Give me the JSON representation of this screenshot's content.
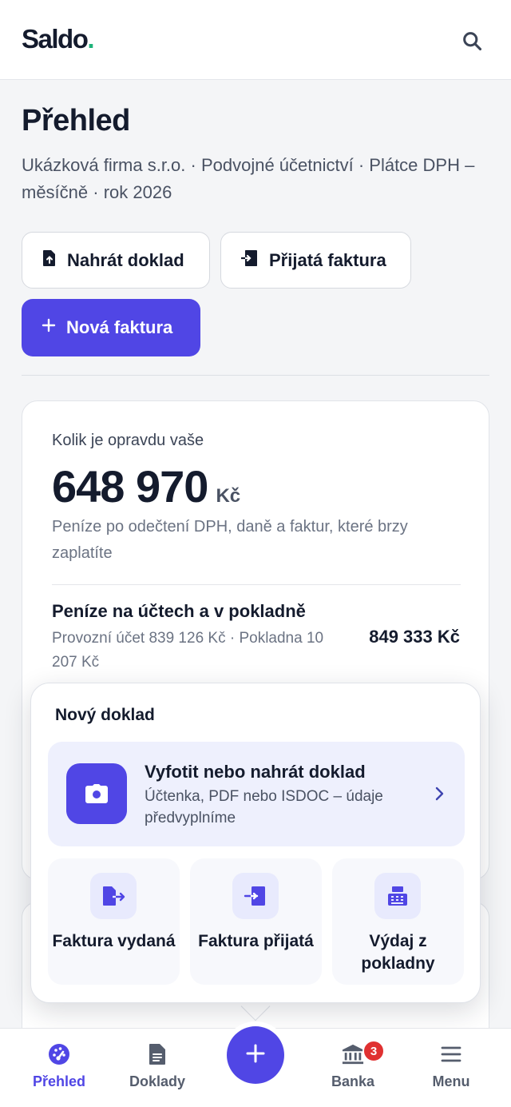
{
  "header": {
    "logo_text": "Saldo",
    "logo_dot": ".",
    "search_icon": "search-icon"
  },
  "page": {
    "title": "Přehled",
    "subtitle": "Ukázková firma s.r.o. · Podvojné účetnictví · Plátce DPH – měsíčně · rok 2026"
  },
  "actions": {
    "upload_label": "Nahrát doklad",
    "received_label": "Přijatá faktura",
    "new_invoice_label": "Nová faktura"
  },
  "summary": {
    "label": "Kolik je opravdu vaše",
    "amount": "648 970",
    "currency": "Kč",
    "note": "Peníze po odečtení DPH, daně a faktur, které brzy zaplatíte",
    "money_title": "Peníze na účtech a v pokladně",
    "money_detail": "Provozní účet 839 126 Kč · Pokladna 10 207 Kč",
    "money_total": "849 333 Kč"
  },
  "new_document_sheet": {
    "title": "Nový doklad",
    "scan": {
      "title": "Vyfotit nebo nahrát doklad",
      "subtitle": "Účtenka, PDF nebo ISDOC – údaje předvyplníme"
    },
    "tiles": [
      {
        "label": "Faktura vydaná",
        "icon": "invoice-out-icon"
      },
      {
        "label": "Faktura přijatá",
        "icon": "invoice-in-icon"
      },
      {
        "label": "Výdaj z pokladny",
        "icon": "cash-register-icon"
      }
    ]
  },
  "nav": {
    "items": [
      {
        "label": "Přehled",
        "icon": "dashboard-icon",
        "active": true
      },
      {
        "label": "Doklady",
        "icon": "document-icon",
        "active": false
      },
      {
        "label": "Banka",
        "icon": "bank-icon",
        "active": false,
        "badge": "3"
      },
      {
        "label": "Menu",
        "icon": "menu-icon",
        "active": false
      }
    ],
    "fab_icon": "plus-icon"
  },
  "colors": {
    "accent": "#5046e5",
    "brand_dot": "#1fb37a",
    "badge": "#e03131",
    "text": "#141b2d"
  }
}
